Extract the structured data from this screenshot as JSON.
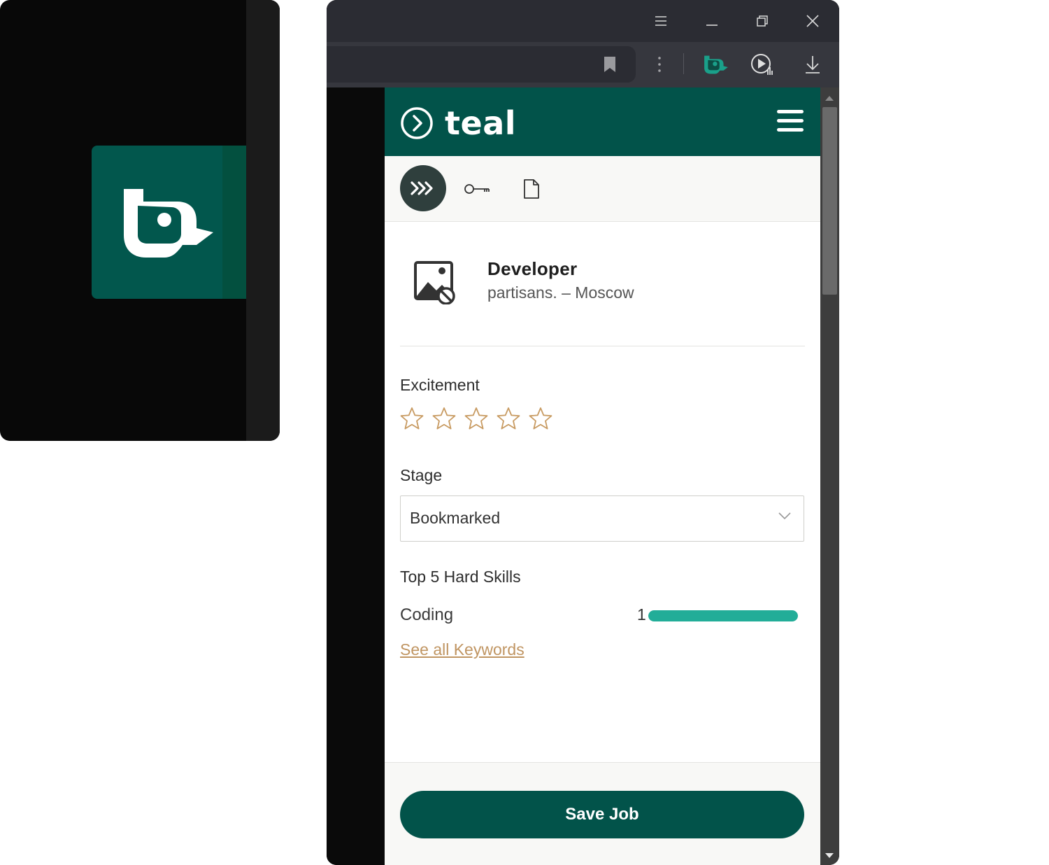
{
  "colors": {
    "brand": "#02534a",
    "accent_bar": "#22ad98",
    "link": "#c09562",
    "star_outline": "#c89b62"
  },
  "icons": {
    "extension_logo": "teal-extension-icon",
    "window": [
      "menu-icon",
      "minimize-icon",
      "restore-icon",
      "close-icon"
    ],
    "toolbar": [
      "bookmark-icon",
      "more-vert-icon",
      "teal-extension-icon",
      "media-control-icon",
      "download-icon"
    ],
    "panel_tabs": [
      "forward-arrows-icon",
      "key-icon",
      "document-icon"
    ]
  },
  "panel": {
    "brand_name": "teal",
    "job": {
      "title": "Developer",
      "company_location": "partisans. – Moscow"
    },
    "excitement": {
      "label": "Excitement",
      "rating": 0,
      "max": 5
    },
    "stage": {
      "label": "Stage",
      "selected": "Bookmarked"
    },
    "hard_skills": {
      "label": "Top 5 Hard Skills",
      "items": [
        {
          "name": "Coding",
          "count": "1",
          "fill": 1.0
        }
      ]
    },
    "see_all_link": "See all Keywords",
    "save_button": "Save Job"
  }
}
